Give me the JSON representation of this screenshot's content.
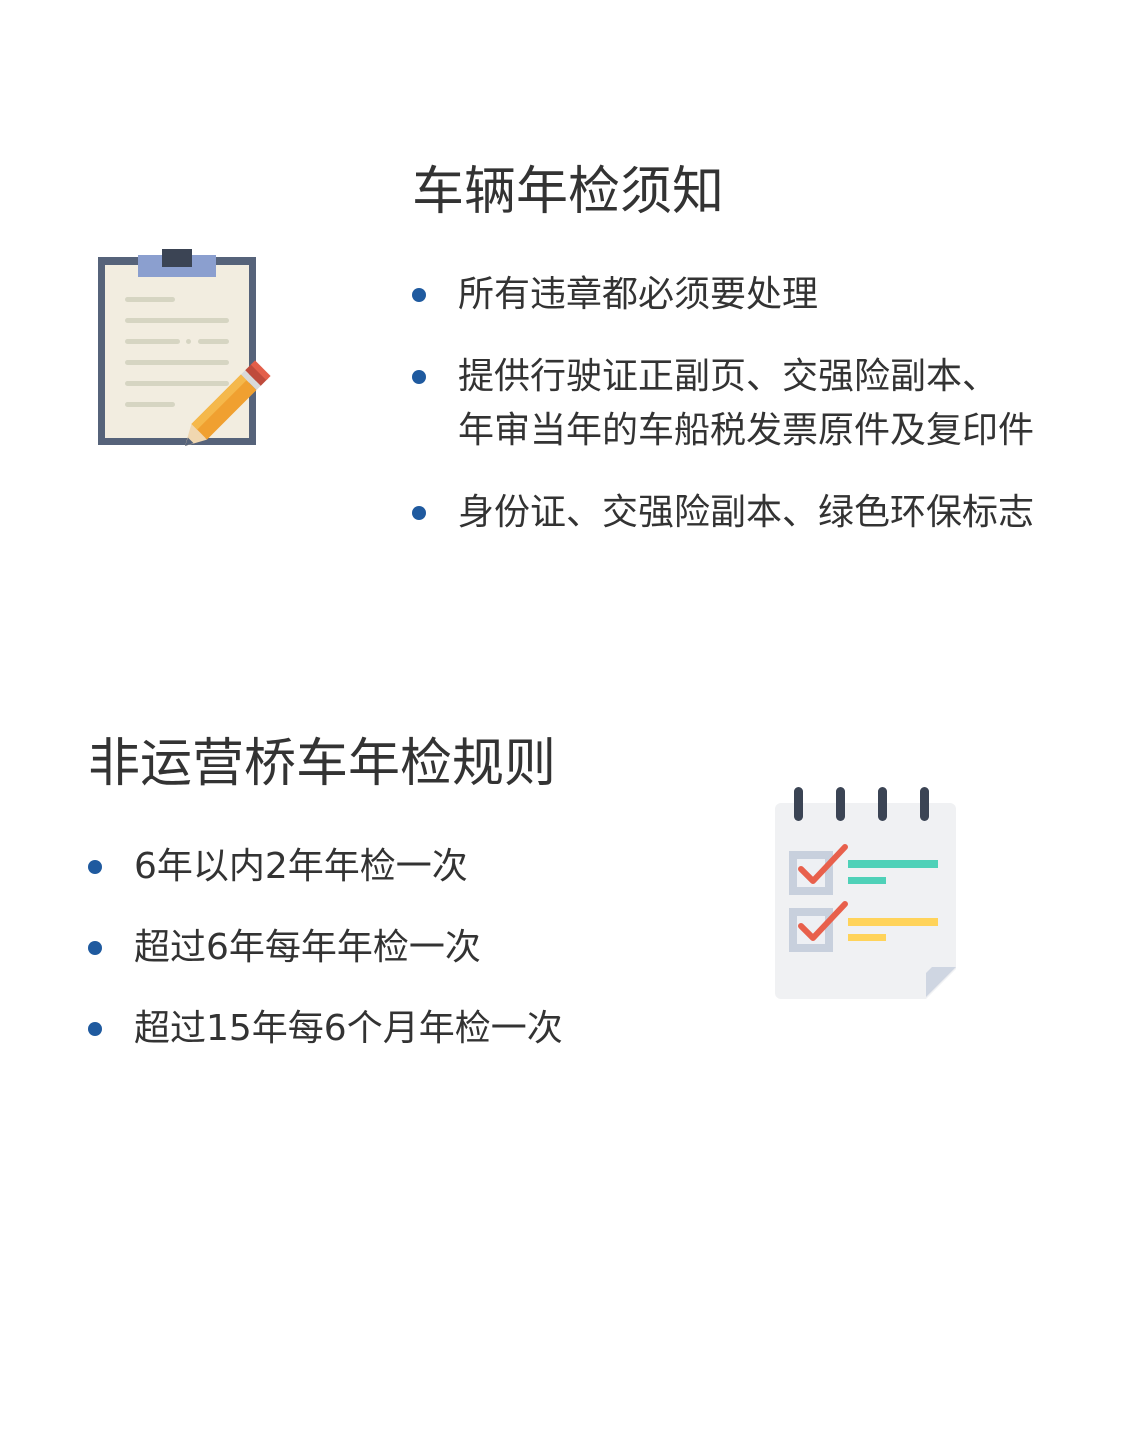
{
  "accent_color": "#1f5a9f",
  "section1": {
    "title": "车辆年检须知",
    "icon": "clipboard-pencil-icon",
    "items": [
      {
        "lines": [
          "所有违章都必须要处理"
        ]
      },
      {
        "lines": [
          "提供行驶证正副页、交强险副本、",
          "年审当年的车船税发票原件及复印件"
        ]
      },
      {
        "lines": [
          "身份证、交强险副本、绿色环保标志"
        ]
      }
    ]
  },
  "section2": {
    "title": "非运营桥车年检规则",
    "icon": "checklist-notepad-icon",
    "items": [
      {
        "lines": [
          "6年以内2年年检一次"
        ]
      },
      {
        "lines": [
          "超过6年每年年检一次"
        ]
      },
      {
        "lines": [
          "超过15年每6个月年检一次"
        ]
      }
    ]
  }
}
